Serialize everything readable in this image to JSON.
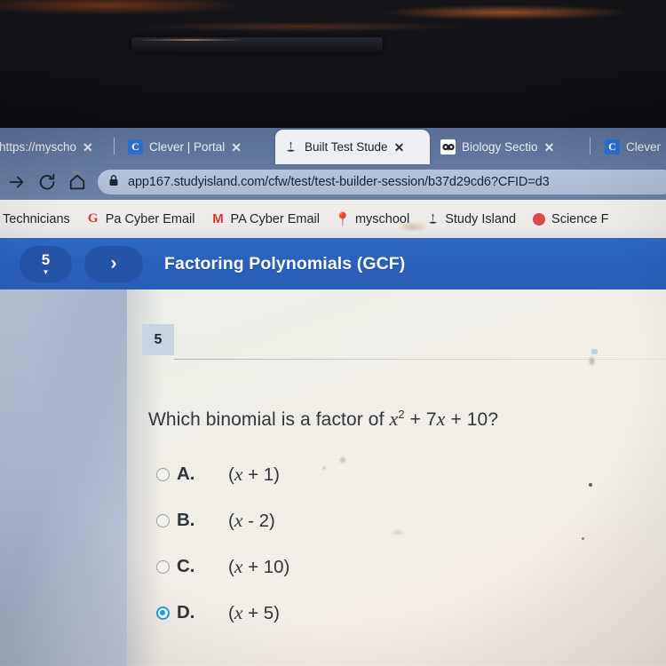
{
  "browser": {
    "tabs": [
      {
        "title": "https://myscho",
        "icon": "none-icon",
        "active": false,
        "close_label": "✕"
      },
      {
        "title": "Clever | Portal",
        "icon": "clever-icon",
        "active": false,
        "close_label": "✕"
      },
      {
        "title": "Built Test Stude",
        "icon": "study-island-icon",
        "active": true,
        "close_label": "✕"
      },
      {
        "title": "Biology Sectio",
        "icon": "owl-icon",
        "active": false,
        "close_label": "✕"
      },
      {
        "title": "Clever",
        "icon": "clever-icon",
        "active": false,
        "close_label": ""
      }
    ],
    "toolbar": {
      "forward_icon": "forward-arrow-icon",
      "reload_icon": "reload-icon",
      "home_icon": "home-icon",
      "lock_icon": "lock-icon",
      "url": "app167.studyisland.com/cfw/test/test-builder-session/b37d29cd6?CFID=d3"
    },
    "bookmarks": [
      {
        "label": "Technicians",
        "icon": "none-icon"
      },
      {
        "label": "Pa Cyber Email",
        "icon": "google-g-icon"
      },
      {
        "label": "PA Cyber Email",
        "icon": "gmail-m-icon"
      },
      {
        "label": "myschool",
        "icon": "pin-icon"
      },
      {
        "label": "Study Island",
        "icon": "study-island-icon"
      },
      {
        "label": "Science F",
        "icon": "red-dot-icon"
      }
    ]
  },
  "app_header": {
    "question_pill": "5",
    "pill_caret": "▼",
    "next_button": "›",
    "title": "Factoring Polynomials (GCF)"
  },
  "question": {
    "number": "5",
    "prompt_prefix": "Which binomial is a factor of ",
    "prompt_var": "x",
    "prompt_exp": "2",
    "prompt_suffix_a": " + 7",
    "prompt_var2": "x",
    "prompt_suffix_b": " + 10?",
    "options": [
      {
        "letter": "A.",
        "open": "(",
        "var": "x",
        "expr": " + 1",
        "close": ")",
        "selected": false
      },
      {
        "letter": "B.",
        "open": "(",
        "var": "x",
        "expr": " - 2",
        "close": ")",
        "selected": false
      },
      {
        "letter": "C.",
        "open": "(",
        "var": "x",
        "expr": " + 10",
        "close": ")",
        "selected": false
      },
      {
        "letter": "D.",
        "open": "(",
        "var": "x",
        "expr": " + 5",
        "close": ")",
        "selected": true
      }
    ]
  },
  "colors": {
    "app_blue": "#2a61bd",
    "pill_blue": "#2554a8",
    "radio_selected": "#1f9fe0",
    "qnum_bg": "#ccd7e4"
  }
}
